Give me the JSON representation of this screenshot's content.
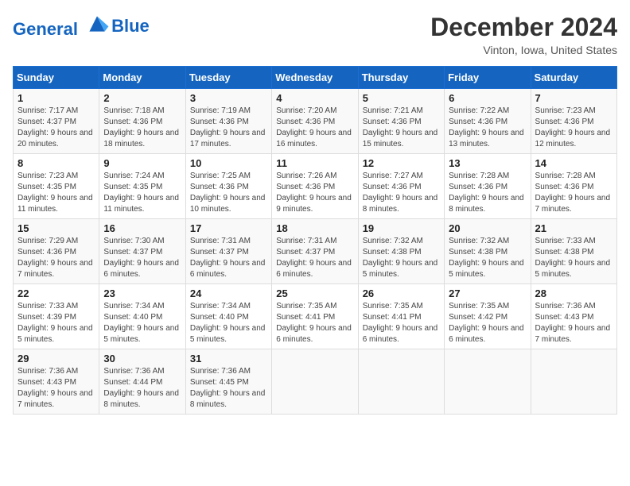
{
  "header": {
    "logo_line1": "General",
    "logo_line2": "Blue",
    "month": "December 2024",
    "location": "Vinton, Iowa, United States"
  },
  "weekdays": [
    "Sunday",
    "Monday",
    "Tuesday",
    "Wednesday",
    "Thursday",
    "Friday",
    "Saturday"
  ],
  "weeks": [
    [
      {
        "day": "1",
        "sunrise": "Sunrise: 7:17 AM",
        "sunset": "Sunset: 4:37 PM",
        "daylight": "Daylight: 9 hours and 20 minutes."
      },
      {
        "day": "2",
        "sunrise": "Sunrise: 7:18 AM",
        "sunset": "Sunset: 4:36 PM",
        "daylight": "Daylight: 9 hours and 18 minutes."
      },
      {
        "day": "3",
        "sunrise": "Sunrise: 7:19 AM",
        "sunset": "Sunset: 4:36 PM",
        "daylight": "Daylight: 9 hours and 17 minutes."
      },
      {
        "day": "4",
        "sunrise": "Sunrise: 7:20 AM",
        "sunset": "Sunset: 4:36 PM",
        "daylight": "Daylight: 9 hours and 16 minutes."
      },
      {
        "day": "5",
        "sunrise": "Sunrise: 7:21 AM",
        "sunset": "Sunset: 4:36 PM",
        "daylight": "Daylight: 9 hours and 15 minutes."
      },
      {
        "day": "6",
        "sunrise": "Sunrise: 7:22 AM",
        "sunset": "Sunset: 4:36 PM",
        "daylight": "Daylight: 9 hours and 13 minutes."
      },
      {
        "day": "7",
        "sunrise": "Sunrise: 7:23 AM",
        "sunset": "Sunset: 4:36 PM",
        "daylight": "Daylight: 9 hours and 12 minutes."
      }
    ],
    [
      {
        "day": "8",
        "sunrise": "Sunrise: 7:23 AM",
        "sunset": "Sunset: 4:35 PM",
        "daylight": "Daylight: 9 hours and 11 minutes."
      },
      {
        "day": "9",
        "sunrise": "Sunrise: 7:24 AM",
        "sunset": "Sunset: 4:35 PM",
        "daylight": "Daylight: 9 hours and 11 minutes."
      },
      {
        "day": "10",
        "sunrise": "Sunrise: 7:25 AM",
        "sunset": "Sunset: 4:36 PM",
        "daylight": "Daylight: 9 hours and 10 minutes."
      },
      {
        "day": "11",
        "sunrise": "Sunrise: 7:26 AM",
        "sunset": "Sunset: 4:36 PM",
        "daylight": "Daylight: 9 hours and 9 minutes."
      },
      {
        "day": "12",
        "sunrise": "Sunrise: 7:27 AM",
        "sunset": "Sunset: 4:36 PM",
        "daylight": "Daylight: 9 hours and 8 minutes."
      },
      {
        "day": "13",
        "sunrise": "Sunrise: 7:28 AM",
        "sunset": "Sunset: 4:36 PM",
        "daylight": "Daylight: 9 hours and 8 minutes."
      },
      {
        "day": "14",
        "sunrise": "Sunrise: 7:28 AM",
        "sunset": "Sunset: 4:36 PM",
        "daylight": "Daylight: 9 hours and 7 minutes."
      }
    ],
    [
      {
        "day": "15",
        "sunrise": "Sunrise: 7:29 AM",
        "sunset": "Sunset: 4:36 PM",
        "daylight": "Daylight: 9 hours and 7 minutes."
      },
      {
        "day": "16",
        "sunrise": "Sunrise: 7:30 AM",
        "sunset": "Sunset: 4:37 PM",
        "daylight": "Daylight: 9 hours and 6 minutes."
      },
      {
        "day": "17",
        "sunrise": "Sunrise: 7:31 AM",
        "sunset": "Sunset: 4:37 PM",
        "daylight": "Daylight: 9 hours and 6 minutes."
      },
      {
        "day": "18",
        "sunrise": "Sunrise: 7:31 AM",
        "sunset": "Sunset: 4:37 PM",
        "daylight": "Daylight: 9 hours and 6 minutes."
      },
      {
        "day": "19",
        "sunrise": "Sunrise: 7:32 AM",
        "sunset": "Sunset: 4:38 PM",
        "daylight": "Daylight: 9 hours and 5 minutes."
      },
      {
        "day": "20",
        "sunrise": "Sunrise: 7:32 AM",
        "sunset": "Sunset: 4:38 PM",
        "daylight": "Daylight: 9 hours and 5 minutes."
      },
      {
        "day": "21",
        "sunrise": "Sunrise: 7:33 AM",
        "sunset": "Sunset: 4:38 PM",
        "daylight": "Daylight: 9 hours and 5 minutes."
      }
    ],
    [
      {
        "day": "22",
        "sunrise": "Sunrise: 7:33 AM",
        "sunset": "Sunset: 4:39 PM",
        "daylight": "Daylight: 9 hours and 5 minutes."
      },
      {
        "day": "23",
        "sunrise": "Sunrise: 7:34 AM",
        "sunset": "Sunset: 4:40 PM",
        "daylight": "Daylight: 9 hours and 5 minutes."
      },
      {
        "day": "24",
        "sunrise": "Sunrise: 7:34 AM",
        "sunset": "Sunset: 4:40 PM",
        "daylight": "Daylight: 9 hours and 5 minutes."
      },
      {
        "day": "25",
        "sunrise": "Sunrise: 7:35 AM",
        "sunset": "Sunset: 4:41 PM",
        "daylight": "Daylight: 9 hours and 6 minutes."
      },
      {
        "day": "26",
        "sunrise": "Sunrise: 7:35 AM",
        "sunset": "Sunset: 4:41 PM",
        "daylight": "Daylight: 9 hours and 6 minutes."
      },
      {
        "day": "27",
        "sunrise": "Sunrise: 7:35 AM",
        "sunset": "Sunset: 4:42 PM",
        "daylight": "Daylight: 9 hours and 6 minutes."
      },
      {
        "day": "28",
        "sunrise": "Sunrise: 7:36 AM",
        "sunset": "Sunset: 4:43 PM",
        "daylight": "Daylight: 9 hours and 7 minutes."
      }
    ],
    [
      {
        "day": "29",
        "sunrise": "Sunrise: 7:36 AM",
        "sunset": "Sunset: 4:43 PM",
        "daylight": "Daylight: 9 hours and 7 minutes."
      },
      {
        "day": "30",
        "sunrise": "Sunrise: 7:36 AM",
        "sunset": "Sunset: 4:44 PM",
        "daylight": "Daylight: 9 hours and 8 minutes."
      },
      {
        "day": "31",
        "sunrise": "Sunrise: 7:36 AM",
        "sunset": "Sunset: 4:45 PM",
        "daylight": "Daylight: 9 hours and 8 minutes."
      },
      null,
      null,
      null,
      null
    ]
  ]
}
